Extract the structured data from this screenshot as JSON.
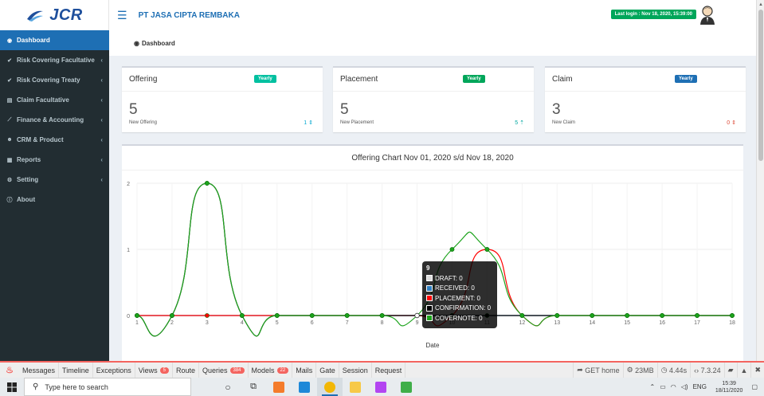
{
  "header": {
    "logo_text": "JCR",
    "company": "PT JASA CIPTA REMBAKA",
    "last_login": "Last login : Nov 18, 2020, 15:39:00"
  },
  "sidebar": {
    "items": [
      {
        "label": "Dashboard",
        "icon": "dashboard-icon",
        "active": true,
        "chevron": false
      },
      {
        "label": "Risk Covering Facultative",
        "icon": "check-circle-icon",
        "active": false,
        "chevron": true
      },
      {
        "label": "Risk Covering Treaty",
        "icon": "check-circle-icon",
        "active": false,
        "chevron": true
      },
      {
        "label": "Claim Facultative",
        "icon": "list-icon",
        "active": false,
        "chevron": true
      },
      {
        "label": "Finance & Accounting",
        "icon": "line-chart-icon",
        "active": false,
        "chevron": true
      },
      {
        "label": "CRM & Product",
        "icon": "users-icon",
        "active": false,
        "chevron": true
      },
      {
        "label": "Reports",
        "icon": "table-icon",
        "active": false,
        "chevron": true
      },
      {
        "label": "Setting",
        "icon": "gears-icon",
        "active": false,
        "chevron": true
      },
      {
        "label": "About",
        "icon": "info-icon",
        "active": false,
        "chevron": false
      }
    ]
  },
  "breadcrumb": "Dashboard",
  "boxes": [
    {
      "title": "Offering",
      "badge": "Yearly",
      "badge_color": "#00c0a0",
      "value": "5",
      "sub": "New Offering",
      "delta": "1 ⇕",
      "delta_color": "#00a7d0"
    },
    {
      "title": "Placement",
      "badge": "Yearly",
      "badge_color": "#00a65a",
      "value": "5",
      "sub": "New Placement",
      "delta": "5 ⇡",
      "delta_color": "#00a7a0"
    },
    {
      "title": "Claim",
      "badge": "Yearly",
      "badge_color": "#1e6fb4",
      "value": "3",
      "sub": "New Claim",
      "delta": "0 ⇕",
      "delta_color": "#dd4b39"
    }
  ],
  "chart_data": {
    "type": "line",
    "title": "Offering Chart Nov 01, 2020 s/d Nov 18, 2020",
    "xlabel": "Date",
    "ylabel": "",
    "x": [
      1,
      2,
      3,
      4,
      5,
      6,
      7,
      8,
      9,
      10,
      11,
      12,
      13,
      14,
      15,
      16,
      17,
      18
    ],
    "ylim": [
      0,
      2
    ],
    "yticks": [
      0,
      1,
      2
    ],
    "grid": true,
    "series": [
      {
        "name": "DRAFT",
        "color": "#ffffff",
        "values": [
          0,
          0,
          0,
          0,
          0,
          0,
          0,
          0,
          0,
          0,
          0,
          0,
          0,
          0,
          0,
          0,
          0,
          0
        ]
      },
      {
        "name": "RECEIVED",
        "color": "#2f7fc1",
        "values": [
          0,
          0,
          0,
          0,
          0,
          0,
          0,
          0,
          0,
          0,
          0,
          0,
          0,
          0,
          0,
          0,
          0,
          0
        ]
      },
      {
        "name": "PLACEMENT",
        "color": "#ff0000",
        "values": [
          0,
          0,
          0,
          0,
          0,
          0,
          0,
          0,
          0,
          0,
          1,
          0,
          0,
          0,
          0,
          0,
          0,
          0
        ]
      },
      {
        "name": "CONFIRMATION",
        "color": "#000000",
        "values": [
          0,
          0,
          2,
          0,
          0,
          0,
          0,
          0,
          0,
          0,
          0,
          0,
          0,
          0,
          0,
          0,
          0,
          0
        ]
      },
      {
        "name": "COVERNOTE",
        "color": "#1ca31c",
        "values": [
          0,
          0,
          2,
          0,
          0,
          0,
          0,
          0,
          0,
          1,
          1,
          0,
          0,
          0,
          0,
          0,
          0,
          0
        ]
      }
    ],
    "tooltip": {
      "title": "9",
      "rows": [
        "DRAFT: 0",
        "RECEIVED: 0",
        "PLACEMENT: 0",
        "CONFIRMATION: 0",
        "COVERNOTE: 0"
      ]
    }
  },
  "debugbar": {
    "tabs": [
      {
        "label": "Messages",
        "count": ""
      },
      {
        "label": "Timeline",
        "count": ""
      },
      {
        "label": "Exceptions",
        "count": ""
      },
      {
        "label": "Views",
        "count": "5"
      },
      {
        "label": "Route",
        "count": ""
      },
      {
        "label": "Queries",
        "count": "384"
      },
      {
        "label": "Models",
        "count": "22"
      },
      {
        "label": "Mails",
        "count": ""
      },
      {
        "label": "Gate",
        "count": ""
      },
      {
        "label": "Session",
        "count": ""
      },
      {
        "label": "Request",
        "count": ""
      }
    ],
    "route": "GET home",
    "memory": "23MB",
    "time": "4.44s",
    "php": "7.3.24"
  },
  "taskbar": {
    "search_placeholder": "Type here to search",
    "lang": "ENG",
    "time": "15:39",
    "date": "18/11/2020"
  }
}
